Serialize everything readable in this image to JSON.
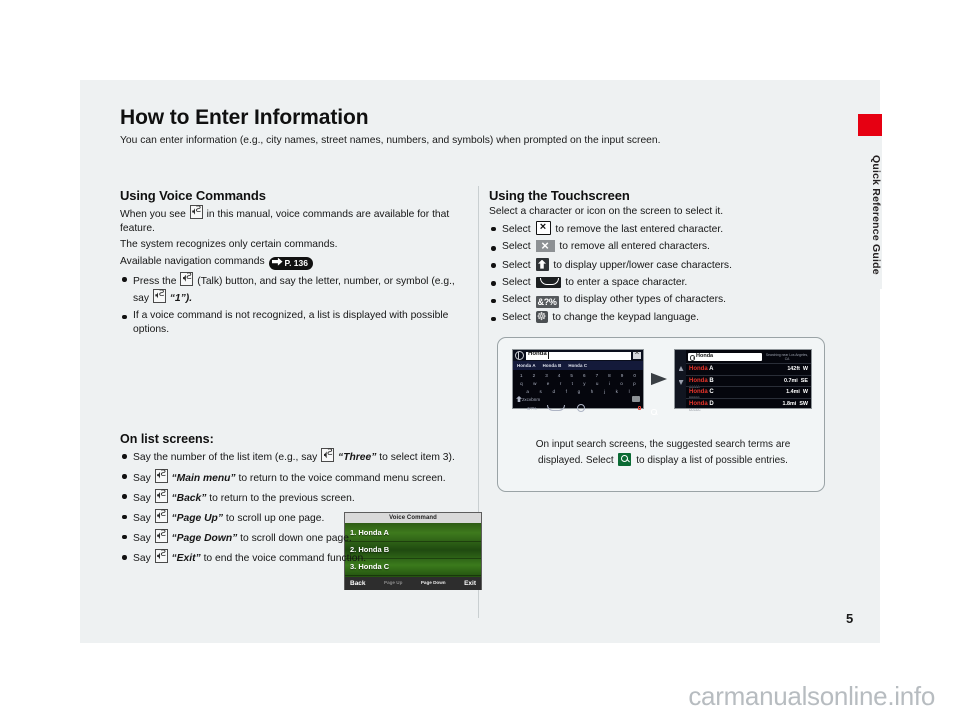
{
  "page": {
    "title": "How to Enter Information",
    "lede": "You can enter information (e.g., city names, street names, numbers, and symbols) when prompted on the input screen.",
    "number": "5",
    "side_tab_label": "Quick Reference Guide",
    "side_tab_color": "#e60012",
    "watermark": "carmanualsonline.info"
  },
  "left": {
    "heading": "Using Voice Commands",
    "p1_a": "When you see",
    "p1_b": "in this manual, voice commands are available for that feature.",
    "p2": "The system recognizes only certain commands.",
    "p3": "Available navigation commands",
    "page_ref": "P. 136",
    "bullets": [
      {
        "a": "Press the",
        "b": "(Talk) button, and say the letter, number, or symbol (e.g., say",
        "c": "“1”)."
      },
      {
        "a": "If a voice command is not recognized, a list is displayed with possible options."
      }
    ],
    "sub_heading": "On list screens:",
    "list_bullets": [
      {
        "pre": "Say the number of the list item (e.g., say",
        "cmd": "“Three”",
        "post": "to select item 3)."
      },
      {
        "pre": "Say",
        "cmd": "“Main menu”",
        "post": "to return to the voice command menu screen."
      },
      {
        "pre": "Say",
        "cmd": "“Back”",
        "post": "to return to the previous screen."
      },
      {
        "pre": "Say",
        "cmd": "“Page Up”",
        "post": "to scroll up one page."
      },
      {
        "pre": "Say",
        "cmd": "“Page Down”",
        "post": "to scroll down one page."
      },
      {
        "pre": "Say",
        "cmd": "“Exit”",
        "post": "to end the voice command function."
      }
    ]
  },
  "voice_screen": {
    "title": "Voice Command",
    "items": [
      "1. Honda A",
      "2. Honda B",
      "3. Honda C"
    ],
    "buttons": {
      "back": "Back",
      "page_up": "Page Up",
      "page_down": "Page Down",
      "exit": "Exit"
    }
  },
  "right": {
    "heading": "Using the Touchscreen",
    "intro": "Select a character or icon on the screen to select it.",
    "bullets": [
      {
        "pre": "Select",
        "icon": "backspace-icon",
        "post": "to remove the last entered character."
      },
      {
        "pre": "Select",
        "icon": "delete-all-icon",
        "post": "to remove all entered characters."
      },
      {
        "pre": "Select",
        "icon": "shift-icon",
        "post": "to display upper/lower case characters."
      },
      {
        "pre": "Select",
        "icon": "space-bar-icon",
        "post": "to enter a space character."
      },
      {
        "pre": "Select",
        "icon": "symbols-icon",
        "label": "&?%",
        "post": "to display other types of characters."
      },
      {
        "pre": "Select",
        "icon": "keypad-language-icon",
        "post": "to change the keypad language."
      }
    ],
    "figure": {
      "caption_a": "On input search screens, the suggested search terms are displayed. Select",
      "caption_b": "to display a list of possible entries.",
      "keyboard": {
        "input_value": "Honda",
        "suggestions": [
          "Honda A",
          "Honda B",
          "Honda C"
        ],
        "row1": [
          "1",
          "2",
          "3",
          "4",
          "5",
          "6",
          "7",
          "8",
          "9",
          "0"
        ],
        "row2": [
          "q",
          "w",
          "e",
          "r",
          "t",
          "y",
          "u",
          "i",
          "o",
          "p"
        ],
        "row3": [
          "a",
          "s",
          "d",
          "f",
          "g",
          "h",
          "j",
          "k",
          "l"
        ],
        "row4": [
          "z",
          "x",
          "c",
          "v",
          "b",
          "n",
          "m"
        ],
        "symbols_key": "&?%",
        "go_key": "search-icon"
      },
      "list": {
        "query": "Honda",
        "near_label": "Searching near Los Angeles, CA",
        "rows": [
          {
            "name": "Honda",
            "suffix": "A",
            "address": "",
            "dist": "142",
            "unit": "ft",
            "dir": "W"
          },
          {
            "name": "Honda",
            "suffix": "B",
            "address": "AAAAA",
            "dist": "0.7",
            "unit": "mi",
            "dir": "SE"
          },
          {
            "name": "Honda",
            "suffix": "C",
            "address": "BBBBB",
            "dist": "1.4",
            "unit": "mi",
            "dir": "W"
          },
          {
            "name": "Honda",
            "suffix": "D",
            "address": "CCCCC",
            "dist": "1.8",
            "unit": "mi",
            "dir": "SW"
          }
        ]
      }
    }
  }
}
